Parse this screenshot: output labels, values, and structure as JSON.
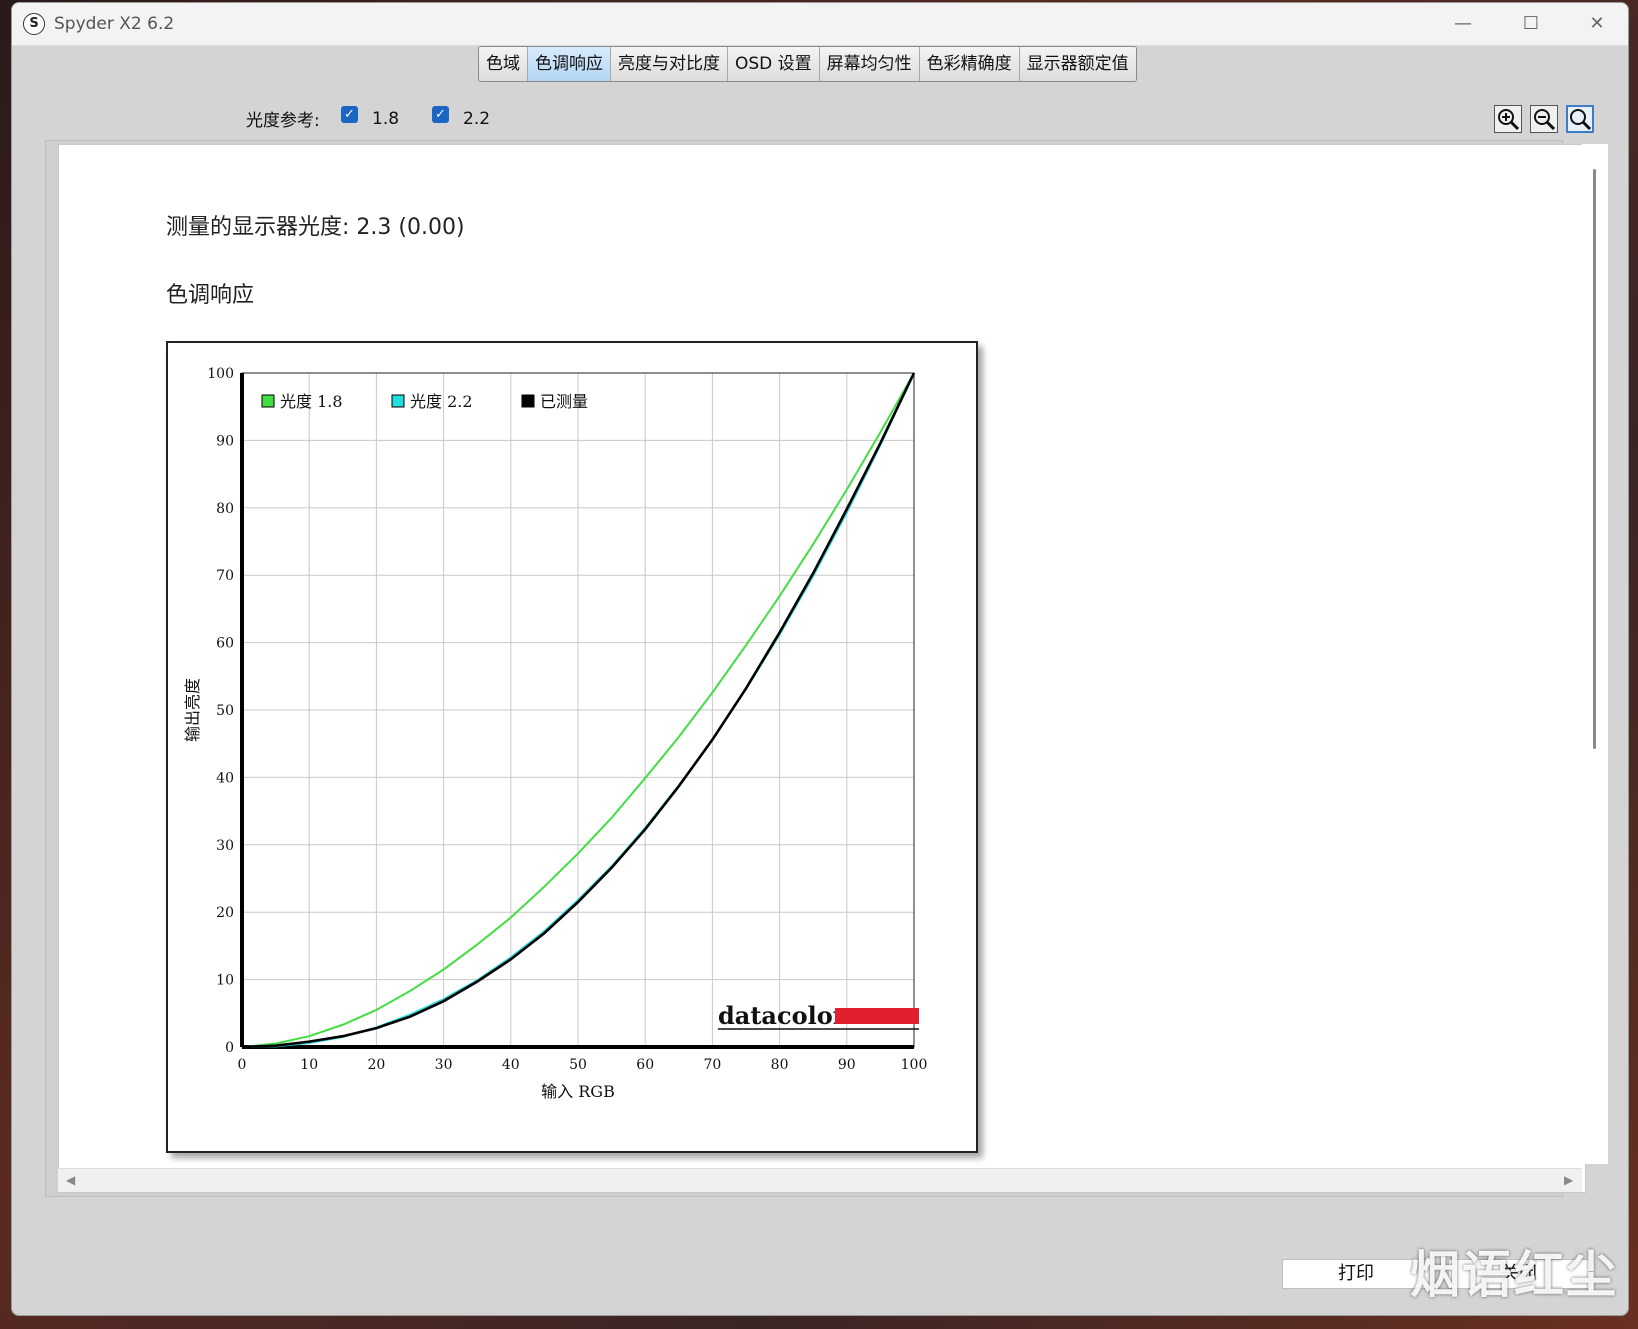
{
  "window": {
    "title": "Spyder X2 6.2",
    "app_icon": "S",
    "min": "—",
    "max": "☐",
    "close": "✕"
  },
  "tabs": [
    {
      "label": "色域",
      "active": false
    },
    {
      "label": "色调响应",
      "active": true
    },
    {
      "label": "亮度与对比度",
      "active": false
    },
    {
      "label": "OSD 设置",
      "active": false
    },
    {
      "label": "屏幕均匀性",
      "active": false
    },
    {
      "label": "色彩精确度",
      "active": false
    },
    {
      "label": "显示器额定值",
      "active": false
    }
  ],
  "gamma_ref": {
    "label": "光度参考:",
    "option1": "1.8",
    "option2": "2.2",
    "checked1": true,
    "checked2": true
  },
  "zoom_icons": [
    "zoom-in-icon",
    "zoom-out-icon",
    "zoom-fit-icon"
  ],
  "content": {
    "measured": "测量的显示器光度: 2.3 (0.00)",
    "section_title": "色调响应"
  },
  "chart_data": {
    "type": "line",
    "xlabel": "输入 RGB",
    "ylabel": "输出亮度",
    "xlim": [
      0,
      100
    ],
    "ylim": [
      0,
      100
    ],
    "xticks": [
      0,
      10,
      20,
      30,
      40,
      50,
      60,
      70,
      80,
      90,
      100
    ],
    "yticks": [
      0,
      10,
      20,
      30,
      40,
      50,
      60,
      70,
      80,
      90,
      100
    ],
    "grid": true,
    "legend": "top-left",
    "brand": "datacolor",
    "x": [
      0,
      5,
      10,
      15,
      20,
      25,
      30,
      35,
      40,
      45,
      50,
      55,
      60,
      65,
      70,
      75,
      80,
      85,
      90,
      95,
      100
    ],
    "series": [
      {
        "name": "光度 1.8",
        "color": "#44dd44",
        "values": [
          0,
          0.5,
          1.6,
          3.3,
          5.5,
          8.3,
          11.5,
          15.2,
          19.2,
          23.8,
          28.7,
          34.0,
          39.9,
          46.0,
          52.6,
          59.6,
          66.9,
          74.6,
          82.7,
          91.2,
          100
        ]
      },
      {
        "name": "光度 2.2",
        "color": "#22dddd",
        "values": [
          0,
          0.1,
          0.6,
          1.5,
          2.9,
          4.8,
          7.1,
          9.9,
          13.3,
          17.2,
          21.8,
          26.8,
          32.5,
          38.8,
          45.6,
          53.1,
          61.2,
          69.9,
          79.3,
          89.3,
          100
        ]
      },
      {
        "name": "已测量",
        "color": "#000000",
        "values": [
          0,
          0.2,
          0.8,
          1.6,
          2.8,
          4.5,
          6.8,
          9.7,
          13.0,
          16.9,
          21.5,
          26.6,
          32.3,
          38.7,
          45.6,
          53.2,
          61.5,
          70.3,
          79.8,
          89.6,
          100
        ]
      }
    ]
  },
  "footer": {
    "print": "打印",
    "close": "关闭"
  },
  "watermark": "烟语红尘",
  "colors": {
    "active_tab": "#b3d6f5",
    "checkbox": "#1a66c2",
    "brand_red": "#e0202e"
  }
}
